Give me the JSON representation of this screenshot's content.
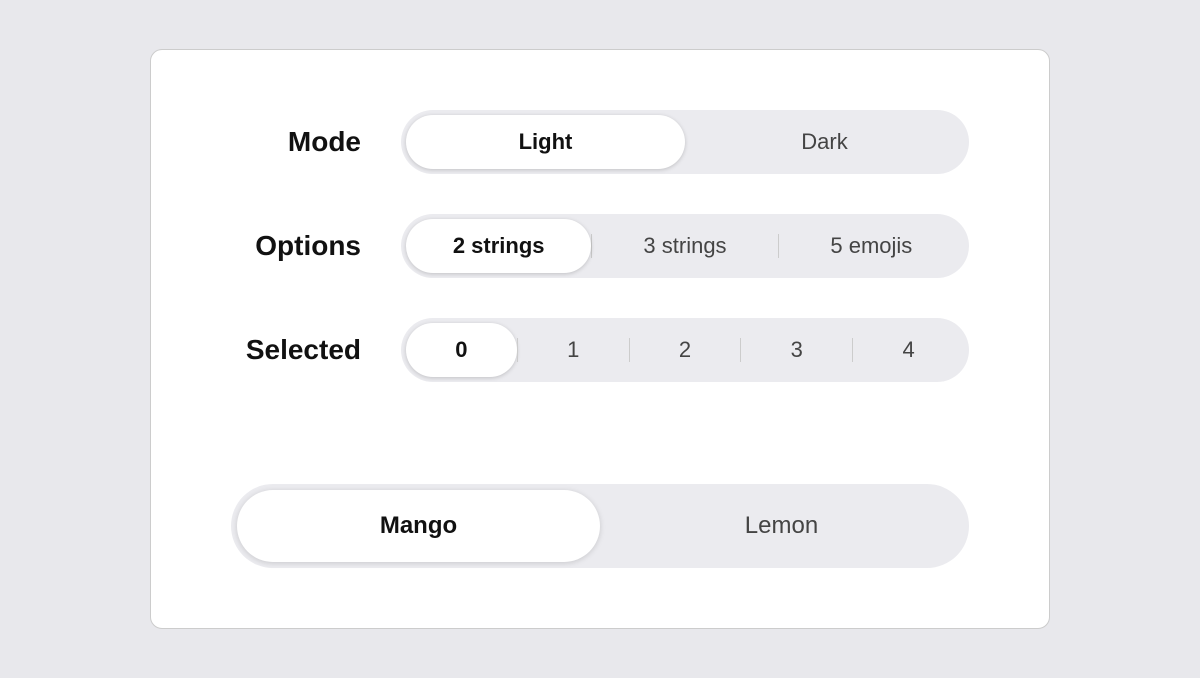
{
  "card": {
    "rows": [
      {
        "label": "Mode",
        "type": "segmented-2",
        "items": [
          {
            "text": "Light",
            "active": true
          },
          {
            "text": "Dark",
            "active": false
          }
        ]
      },
      {
        "label": "Options",
        "type": "segmented-3",
        "items": [
          {
            "text": "2 strings",
            "active": true
          },
          {
            "text": "3 strings",
            "active": false
          },
          {
            "text": "5 emojis",
            "active": false
          }
        ]
      },
      {
        "label": "Selected",
        "type": "segmented-numbers",
        "items": [
          {
            "text": "0",
            "active": true
          },
          {
            "text": "1",
            "active": false
          },
          {
            "text": "2",
            "active": false
          },
          {
            "text": "3",
            "active": false
          },
          {
            "text": "4",
            "active": false
          }
        ]
      }
    ],
    "bottom": {
      "items": [
        {
          "text": "Mango",
          "active": true
        },
        {
          "text": "Lemon",
          "active": false
        }
      ]
    }
  }
}
